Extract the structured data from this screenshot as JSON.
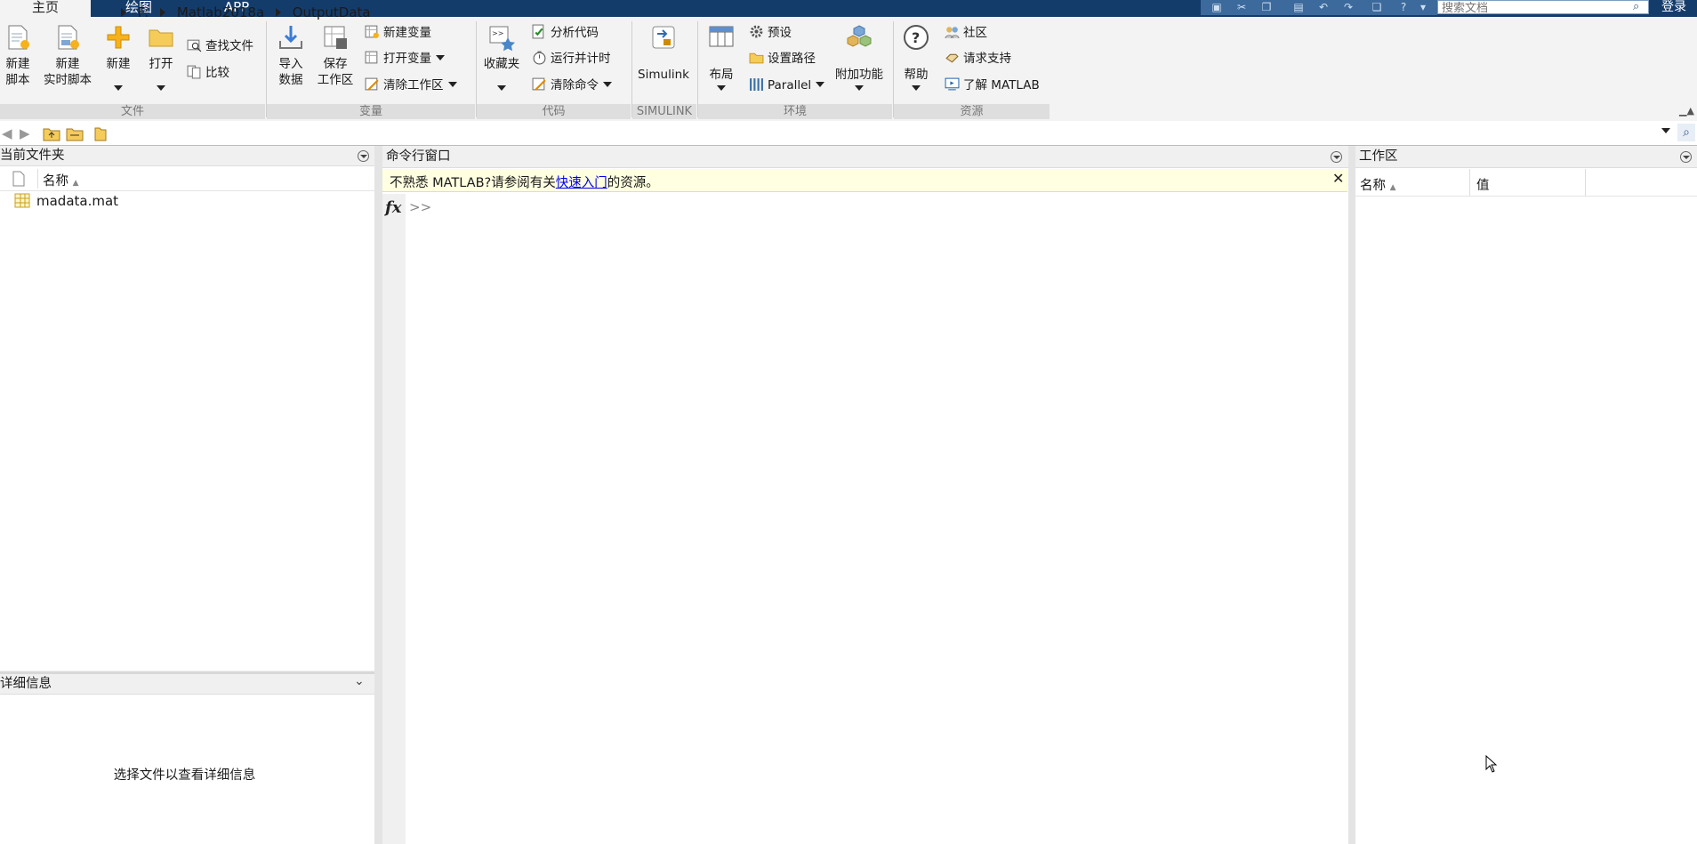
{
  "tabs": [
    {
      "label": "主页",
      "active": true
    },
    {
      "label": "绘图",
      "active": false
    },
    {
      "label": "APP",
      "active": false
    }
  ],
  "search": {
    "placeholder": "搜索文档"
  },
  "login_label": "登录",
  "ribbon": {
    "file": {
      "group_label": "文件",
      "new_script": [
        "新建",
        "脚本"
      ],
      "new_live_script": [
        "新建",
        "实时脚本"
      ],
      "new": "新建",
      "open": "打开",
      "find_files": "查找文件",
      "compare": "比较"
    },
    "variable": {
      "group_label": "变量",
      "import_data": [
        "导入",
        "数据"
      ],
      "save_workspace": [
        "保存",
        "工作区"
      ],
      "new_variable": "新建变量",
      "open_variable": "打开变量",
      "clear_workspace": "清除工作区"
    },
    "code": {
      "group_label": "代码",
      "favorites": "收藏夹",
      "analyze_code": "分析代码",
      "run_and_time": "运行并计时",
      "clear_commands": "清除命令"
    },
    "simulink": {
      "group_label": "SIMULINK",
      "simulink": "Simulink"
    },
    "environment": {
      "group_label": "环境",
      "layout": "布局",
      "preferences": "预设",
      "set_path": "设置路径",
      "parallel": "Parallel",
      "add_ons": "附加功能"
    },
    "resources": {
      "group_label": "资源",
      "help": "帮助",
      "community": "社区",
      "request_support": "请求支持",
      "learn_matlab": "了解 MATLAB"
    }
  },
  "address": {
    "crumbs": [
      "F:",
      "Matlab2018a",
      "OutputData"
    ]
  },
  "current_folder": {
    "title": "当前文件夹",
    "name_header": "名称",
    "files": [
      {
        "name": "madata.mat"
      }
    ]
  },
  "details": {
    "title": "详细信息",
    "message": "选择文件以查看详细信息"
  },
  "command_window": {
    "title": "命令行窗口",
    "notice_before": "不熟悉 MATLAB?请参阅有关",
    "notice_link": "快速入门",
    "notice_after": "的资源。",
    "prompt": ">>"
  },
  "workspace": {
    "title": "工作区",
    "name_header": "名称",
    "value_header": "值"
  },
  "colors": {
    "tabbar": "#143c6b",
    "link": "#0000ee",
    "notice_bg": "#ffffe1"
  }
}
